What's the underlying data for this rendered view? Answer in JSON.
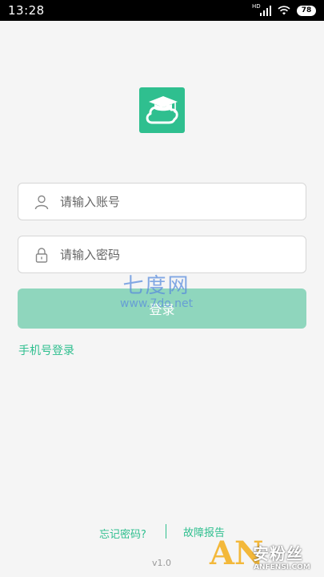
{
  "status_bar": {
    "time": "13:28",
    "network_label": "HD",
    "battery": "78",
    "icons": [
      "hd-signal-icon",
      "wifi-icon",
      "battery-icon"
    ]
  },
  "logo": {
    "icon": "graduation-cap-cloud-icon",
    "color": "#2fbf8f"
  },
  "account_field": {
    "placeholder": "请输入账号",
    "value": "",
    "icon": "user-icon"
  },
  "password_field": {
    "placeholder": "请输入密码",
    "value": "",
    "icon": "lock-icon"
  },
  "login_button": {
    "label": "登录",
    "color": "#8fd6bd"
  },
  "phone_login": {
    "label": "手机号登录"
  },
  "footer": {
    "forgot_password": "忘记密码?",
    "report_issue": "故障报告",
    "version": "v1.0"
  },
  "watermarks": {
    "site_cn": "七度网",
    "site_url": "www.7do.net",
    "brand_letters": "AN",
    "brand_cn": "安粉丝",
    "brand_en": "ANFENSI.COM"
  },
  "colors": {
    "accent": "#2fbf8f",
    "background": "#f5f5f5"
  }
}
